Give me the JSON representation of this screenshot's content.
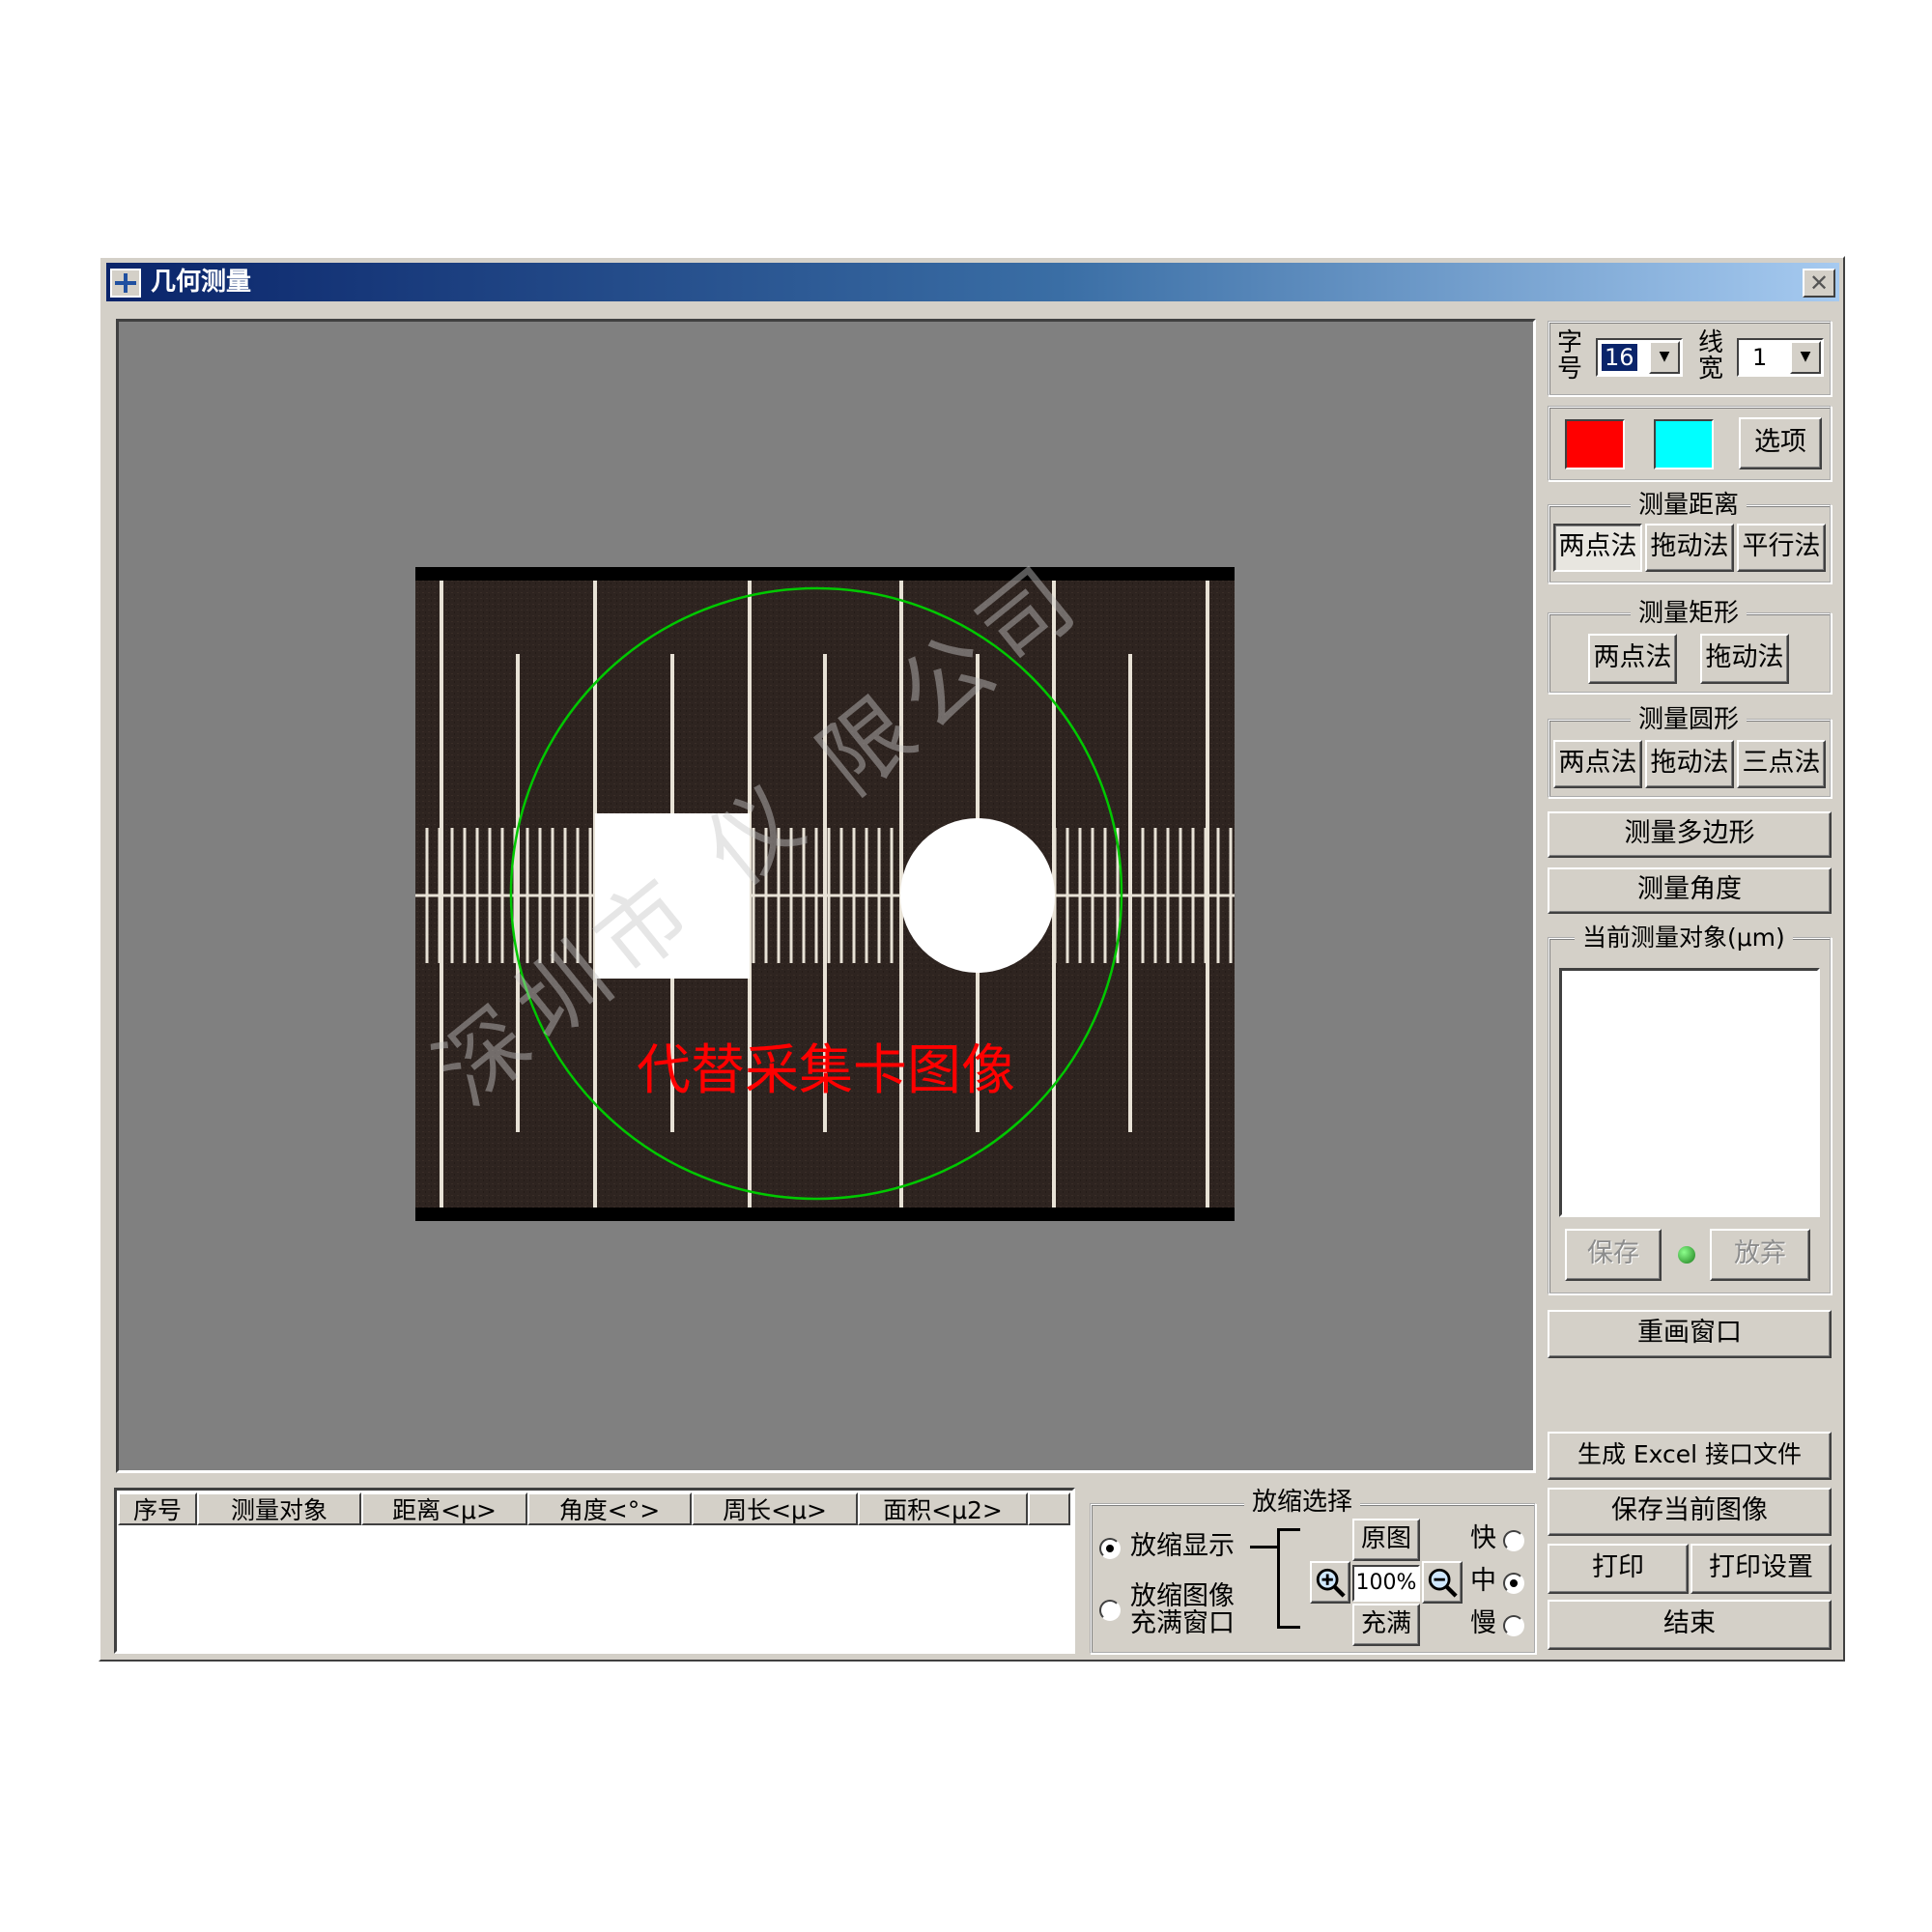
{
  "window": {
    "title": "几何测量",
    "close_glyph": "✕"
  },
  "watermark": "深圳市    仪    限公司",
  "canvas": {
    "overlay_text": "代替采集卡图像",
    "circle_color": "#00c800",
    "text_color": "#ff0000"
  },
  "toolbar": {
    "font_size_label": "字号",
    "font_size_value": "16",
    "line_width_label": "线宽",
    "line_width_value": "1",
    "color1": "#ff0000",
    "color2": "#00ffff",
    "options_label": "选项"
  },
  "distance_group": {
    "title": "测量距离",
    "btn1": "两点法",
    "btn2": "拖动法",
    "btn3": "平行法"
  },
  "rect_group": {
    "title": "测量矩形",
    "btn1": "两点法",
    "btn2": "拖动法"
  },
  "circle_group": {
    "title": "测量圆形",
    "btn1": "两点法",
    "btn2": "拖动法",
    "btn3": "三点法"
  },
  "polygon_label": "测量多边形",
  "angle_label": "测量角度",
  "current_group": {
    "title": "当前测量对象(μm)",
    "save_label": "保存",
    "discard_label": "放弃"
  },
  "redraw_label": "重画窗口",
  "excel_label": "生成 Excel 接口文件",
  "save_image_label": "保存当前图像",
  "print_label": "打印",
  "print_setup_label": "打印设置",
  "exit_label": "结束",
  "table": {
    "columns": [
      "序号",
      "测量对象",
      "距离<μ>",
      "角度<°>",
      "周长<μ>",
      "面积<μ2>"
    ]
  },
  "zoom": {
    "title": "放缩选择",
    "mode1": "放缩显示",
    "mode2_line1": "放缩图像",
    "mode2_line2": "充满窗口",
    "original_label": "原图",
    "percent": "100%",
    "fill_label": "充满",
    "speed_fast": "快",
    "speed_mid": "中",
    "speed_slow": "慢"
  }
}
